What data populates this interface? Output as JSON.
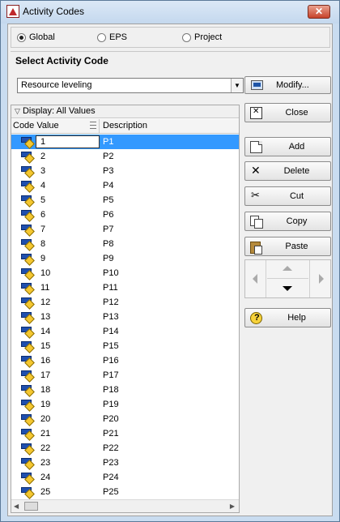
{
  "window": {
    "title": "Activity Codes"
  },
  "scope": {
    "options": [
      {
        "label": "Global",
        "selected": true
      },
      {
        "label": "EPS",
        "selected": false
      },
      {
        "label": "Project",
        "selected": false
      }
    ]
  },
  "section": {
    "title": "Select Activity Code"
  },
  "activity_code_select": {
    "value": "Resource leveling"
  },
  "modify_button": {
    "label": "Modify..."
  },
  "grid": {
    "filter_label": "Display: All Values",
    "columns": [
      "Code Value",
      "Description"
    ],
    "rows": [
      {
        "code": "1",
        "desc": "P1"
      },
      {
        "code": "2",
        "desc": "P2"
      },
      {
        "code": "3",
        "desc": "P3"
      },
      {
        "code": "4",
        "desc": "P4"
      },
      {
        "code": "5",
        "desc": "P5"
      },
      {
        "code": "6",
        "desc": "P6"
      },
      {
        "code": "7",
        "desc": "P7"
      },
      {
        "code": "8",
        "desc": "P8"
      },
      {
        "code": "9",
        "desc": "P9"
      },
      {
        "code": "10",
        "desc": "P10"
      },
      {
        "code": "11",
        "desc": "P11"
      },
      {
        "code": "12",
        "desc": "P12"
      },
      {
        "code": "13",
        "desc": "P13"
      },
      {
        "code": "14",
        "desc": "P14"
      },
      {
        "code": "15",
        "desc": "P15"
      },
      {
        "code": "16",
        "desc": "P16"
      },
      {
        "code": "17",
        "desc": "P17"
      },
      {
        "code": "18",
        "desc": "P18"
      },
      {
        "code": "19",
        "desc": "P19"
      },
      {
        "code": "20",
        "desc": "P20"
      },
      {
        "code": "21",
        "desc": "P21"
      },
      {
        "code": "22",
        "desc": "P22"
      },
      {
        "code": "23",
        "desc": "P23"
      },
      {
        "code": "24",
        "desc": "P24"
      },
      {
        "code": "25",
        "desc": "P25"
      }
    ],
    "selected_index": 0
  },
  "buttons": {
    "close": "Close",
    "add": "Add",
    "delete": "Delete",
    "cut": "Cut",
    "copy": "Copy",
    "paste": "Paste",
    "help": "Help"
  }
}
